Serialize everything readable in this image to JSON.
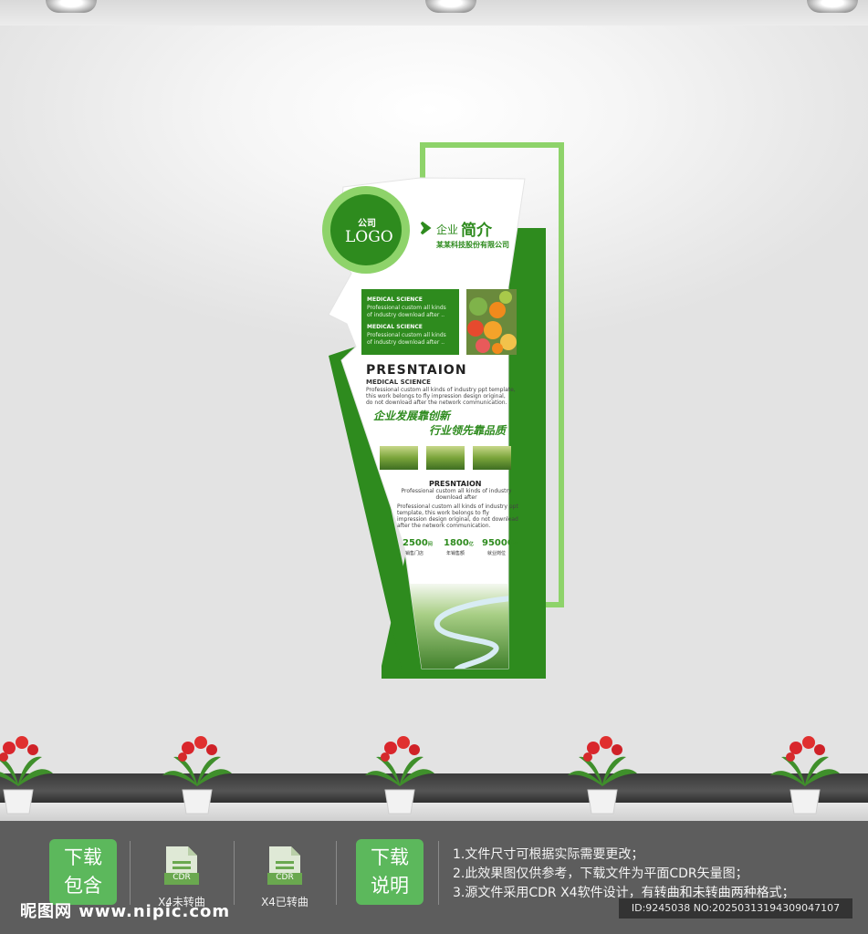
{
  "panel": {
    "logo_top": "公司",
    "logo_main": "LOGO",
    "header_prefix": "企业",
    "header_title": "简介",
    "company": "某某科技股份有限公司",
    "box_heading_1": "MEDICAL SCIENCE",
    "box_text_1a": "Professional custom all kinds",
    "box_text_1b": "of industry download after ..",
    "box_heading_2": "MEDICAL SCIENCE",
    "box_text_2a": "Professional custom all kinds",
    "box_text_2b": "of industry download after ..",
    "section_title": "PRESNTAION",
    "section_sub": "MEDICAL SCIENCE",
    "para_1": "Professional custom all kinds of industry ppt template,",
    "para_2": "this work belongs to fly impression design original,",
    "para_3": "do not download after the network communication.",
    "slogan_1": "企业发展靠创新",
    "slogan_2": "行业领先靠品质",
    "section2_title": "PRESNTAION",
    "section2_sub_1": "Professional custom all kinds of industry",
    "section2_sub_2": "download after",
    "para2_1": "Professional custom all kinds of industry ppt",
    "para2_2": "template, this work belongs to fly",
    "para2_3": "impression design original, do not download",
    "para2_4": "after the network communication.",
    "stats": [
      {
        "value": "2500",
        "unit": "间",
        "label": "销售门店"
      },
      {
        "value": "1800",
        "unit": "亿",
        "label": "年销售额"
      },
      {
        "value": "95000",
        "unit": "个",
        "label": "就业岗位"
      }
    ]
  },
  "bottom": {
    "btn_include_1": "下载",
    "btn_include_2": "包含",
    "file1_badge": "CDR",
    "file1_label": "X4未转曲",
    "file2_badge": "CDR",
    "file2_label": "X4已转曲",
    "btn_note_1": "下载",
    "btn_note_2": "说明",
    "note_1": "1.文件尺寸可根据实际需要更改；",
    "note_2": "2.此效果图仅供参考，下载文件为平面CDR矢量图；",
    "note_3": "3.源文件采用CDR X4软件设计，有转曲和未转曲两种格式；",
    "watermark": "昵图网 www.nipic.com",
    "id_text": "ID:9245038 NO:20250313194309047107"
  },
  "colors": {
    "brand_green": "#2e8b1e",
    "light_green": "#8ed36a",
    "bar_gray": "#5d5d5d"
  }
}
